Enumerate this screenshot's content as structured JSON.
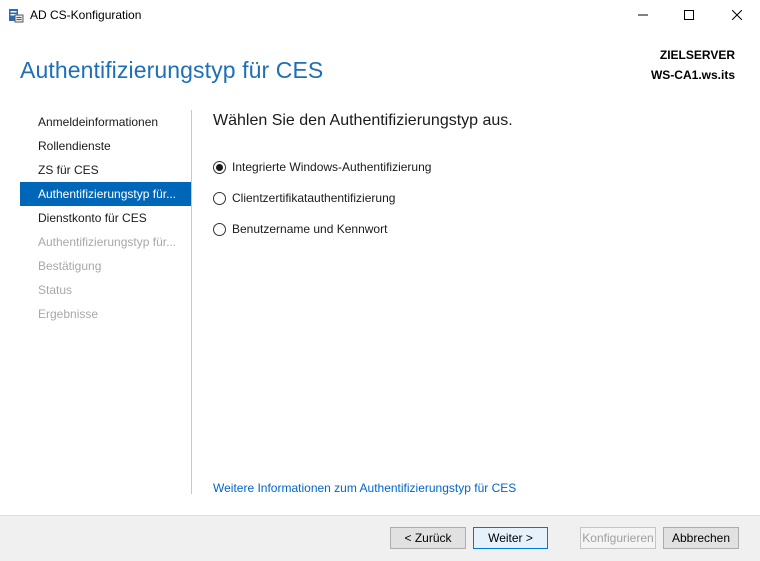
{
  "window": {
    "title": "AD CS-Konfiguration"
  },
  "header": {
    "title": "Authentifizierungstyp für CES",
    "target_label": "ZIELSERVER",
    "target_value": "WS-CA1.ws.its"
  },
  "sidebar": {
    "items": [
      {
        "label": "Anmeldeinformationen",
        "state": "normal"
      },
      {
        "label": "Rollendienste",
        "state": "normal"
      },
      {
        "label": "ZS für CES",
        "state": "normal"
      },
      {
        "label": "Authentifizierungstyp für...",
        "state": "active"
      },
      {
        "label": "Dienstkonto für CES",
        "state": "normal"
      },
      {
        "label": "Authentifizierungstyp für...",
        "state": "disabled"
      },
      {
        "label": "Bestätigung",
        "state": "disabled"
      },
      {
        "label": "Status",
        "state": "disabled"
      },
      {
        "label": "Ergebnisse",
        "state": "disabled"
      }
    ]
  },
  "main": {
    "heading": "Wählen Sie den Authentifizierungstyp aus.",
    "options": [
      {
        "label": "Integrierte Windows-Authentifizierung",
        "selected": true
      },
      {
        "label": "Clientzertifikatauthentifizierung",
        "selected": false
      },
      {
        "label": "Benutzername und Kennwort",
        "selected": false
      }
    ],
    "more_info_link": "Weitere Informationen zum Authentifizierungstyp für CES"
  },
  "footer": {
    "back_label": "< Zurück",
    "next_label": "Weiter >",
    "configure_label": "Konfigurieren",
    "cancel_label": "Abbrechen"
  },
  "colors": {
    "accent": "#0067b8",
    "title": "#1e6fb6",
    "link": "#0066cc"
  }
}
